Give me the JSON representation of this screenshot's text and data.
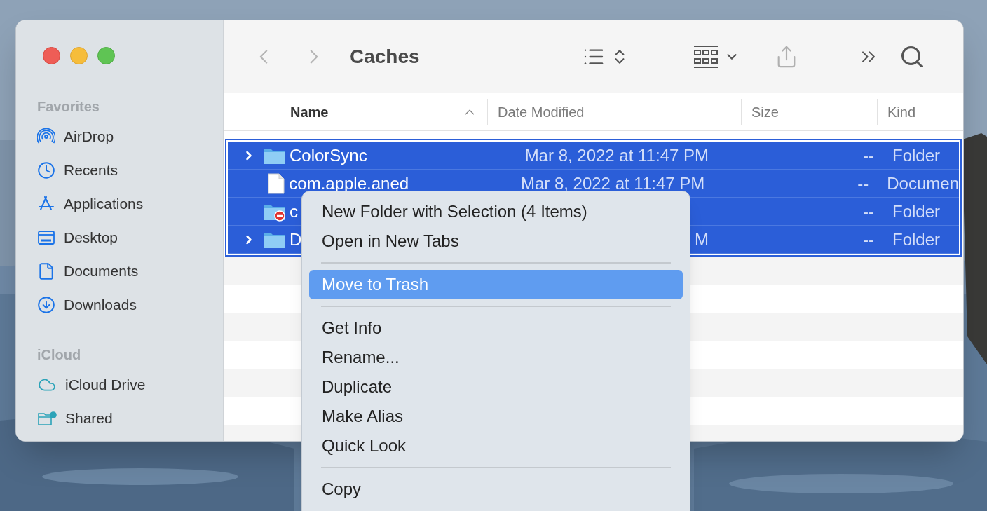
{
  "window": {
    "title": "Caches"
  },
  "sidebar": {
    "sections": [
      {
        "heading": "Favorites",
        "items": [
          {
            "label": "AirDrop"
          },
          {
            "label": "Recents"
          },
          {
            "label": "Applications"
          },
          {
            "label": "Desktop"
          },
          {
            "label": "Documents"
          },
          {
            "label": "Downloads"
          }
        ]
      },
      {
        "heading": "iCloud",
        "items": [
          {
            "label": "iCloud Drive"
          },
          {
            "label": "Shared"
          }
        ]
      }
    ]
  },
  "table": {
    "columns": [
      {
        "label": "Name",
        "sorted": true
      },
      {
        "label": "Date Modified",
        "sorted": false
      },
      {
        "label": "Size",
        "sorted": false
      },
      {
        "label": "Kind",
        "sorted": false
      }
    ],
    "rows": [
      {
        "kind": "folder",
        "selected": true,
        "name": "ColorSync",
        "date": "Mar 8, 2022 at 11:47 PM",
        "size": "--",
        "type": "Folder"
      },
      {
        "kind": "document",
        "selected": true,
        "name": "com.apple.aned",
        "date": "Mar 8, 2022 at 11:47 PM",
        "size": "--",
        "type": "Documen"
      },
      {
        "kind": "locked-folder",
        "selected": true,
        "name": "c",
        "size": "--",
        "type": "Folder"
      },
      {
        "kind": "folder",
        "selected": true,
        "name": "D",
        "date": "M",
        "size": "--",
        "type": "Folder"
      }
    ]
  },
  "context_menu": {
    "items": [
      {
        "kind": "item",
        "label": "New Folder with Selection (4 Items)",
        "selected": false
      },
      {
        "kind": "item",
        "label": "Open in New Tabs",
        "selected": false
      },
      {
        "kind": "separator"
      },
      {
        "kind": "item",
        "label": "Move to Trash",
        "selected": true
      },
      {
        "kind": "separator"
      },
      {
        "kind": "item",
        "label": "Get Info",
        "selected": false
      },
      {
        "kind": "item",
        "label": "Rename...",
        "selected": false
      },
      {
        "kind": "item",
        "label": "Duplicate",
        "selected": false
      },
      {
        "kind": "item",
        "label": "Make Alias",
        "selected": false
      },
      {
        "kind": "item",
        "label": "Quick Look",
        "selected": false
      },
      {
        "kind": "separator"
      },
      {
        "kind": "item",
        "label": "Copy",
        "selected": false
      }
    ]
  }
}
